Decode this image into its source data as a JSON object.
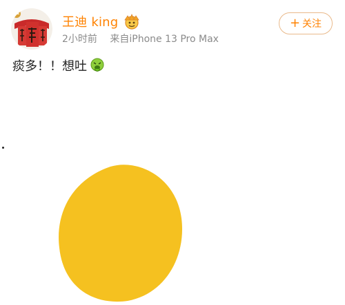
{
  "header": {
    "username": "王迪 king",
    "time": "2小时前",
    "device": "来自iPhone 13 Pro Max",
    "follow_plus": "+",
    "follow_label": "关注"
  },
  "post": {
    "text": "痰多！！想吐"
  },
  "colors": {
    "username": "#ff8200",
    "meta": "#8a8a8a",
    "follow_border": "#e9b98a",
    "blob": "#f5c120"
  },
  "icons": {
    "avatar": "fu-couplet-avatar",
    "badge": "vip-crown-icon",
    "emoji": "vomit-emoji-icon"
  }
}
